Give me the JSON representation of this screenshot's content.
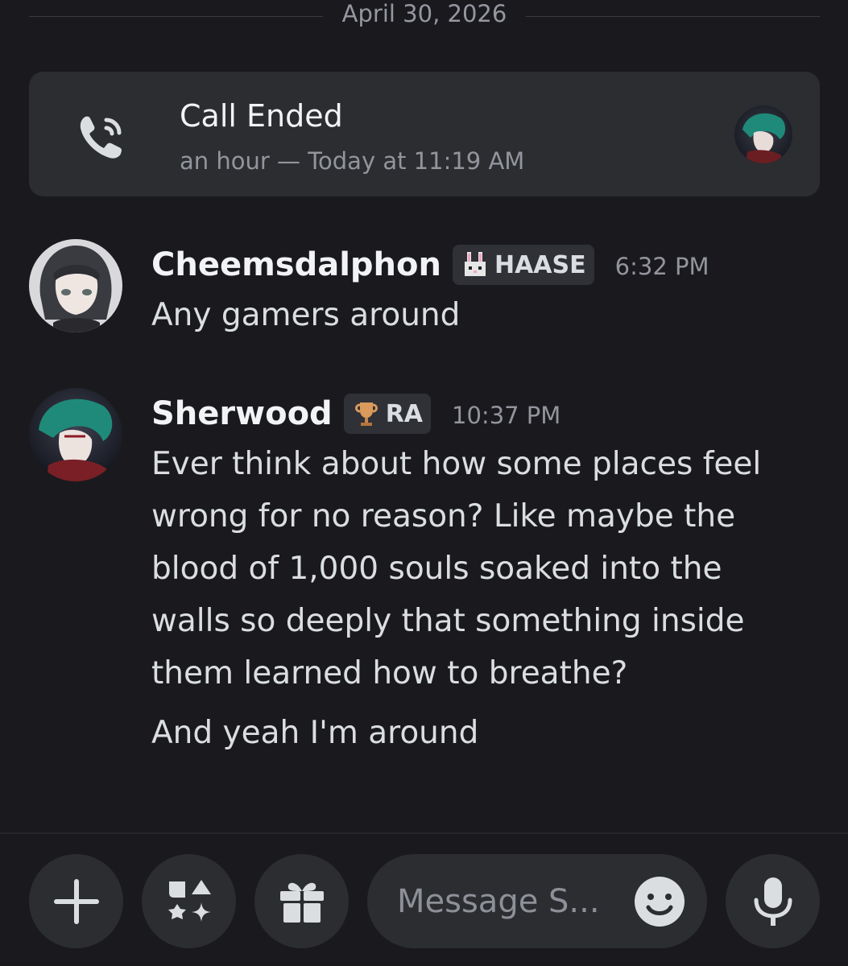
{
  "date_divider": "April 30, 2026",
  "call": {
    "title": "Call Ended",
    "subtitle": "an hour — Today at 11:19 AM"
  },
  "messages": [
    {
      "username": "Cheemsdalphon",
      "tag": {
        "label": "HAASE",
        "icon": "bunny-icon"
      },
      "timestamp": "6:32 PM",
      "lines": [
        "Any gamers around"
      ]
    },
    {
      "username": "Sherwood",
      "tag": {
        "label": "RA",
        "icon": "trophy-icon"
      },
      "timestamp": "10:37 PM",
      "lines": [
        "Ever think about how some places feel",
        "wrong for no reason? Like maybe the",
        "blood of 1,000 souls soaked into the",
        "walls so deeply that something inside",
        "them learned how to breathe?"
      ],
      "followup": "And yeah I'm around"
    }
  ],
  "composer": {
    "placeholder": "Message S...",
    "buttons": [
      "plus-icon",
      "apps-icon",
      "gift-icon",
      "emoji-icon",
      "microphone-icon"
    ]
  },
  "colors": {
    "background": "#1a1a1e",
    "card": "#2b2d31",
    "text": "#dbdee1",
    "muted": "#93959d"
  }
}
